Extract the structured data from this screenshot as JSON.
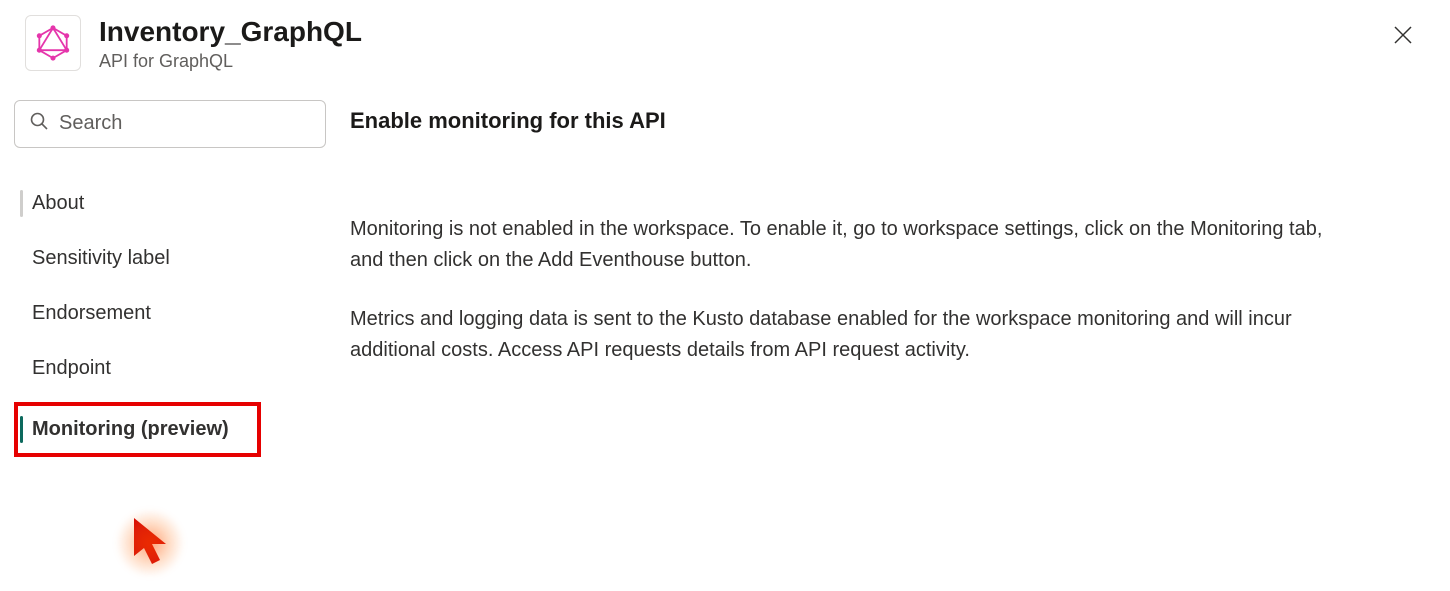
{
  "header": {
    "title": "Inventory_GraphQL",
    "subtitle": "API for GraphQL"
  },
  "search": {
    "placeholder": "Search"
  },
  "sidebar": {
    "items": [
      {
        "label": "About"
      },
      {
        "label": "Sensitivity label"
      },
      {
        "label": "Endorsement"
      },
      {
        "label": "Endpoint"
      },
      {
        "label": "Monitoring (preview)"
      }
    ]
  },
  "main": {
    "heading": "Enable monitoring for this API",
    "paragraph1": "Monitoring is not enabled in the workspace. To enable it, go to workspace settings, click on the Monitoring tab, and then click on the Add Eventhouse button.",
    "paragraph2": "Metrics and logging data is sent to the Kusto database enabled for the workspace monitoring and will incur additional costs. Access API requests details from API request activity."
  }
}
